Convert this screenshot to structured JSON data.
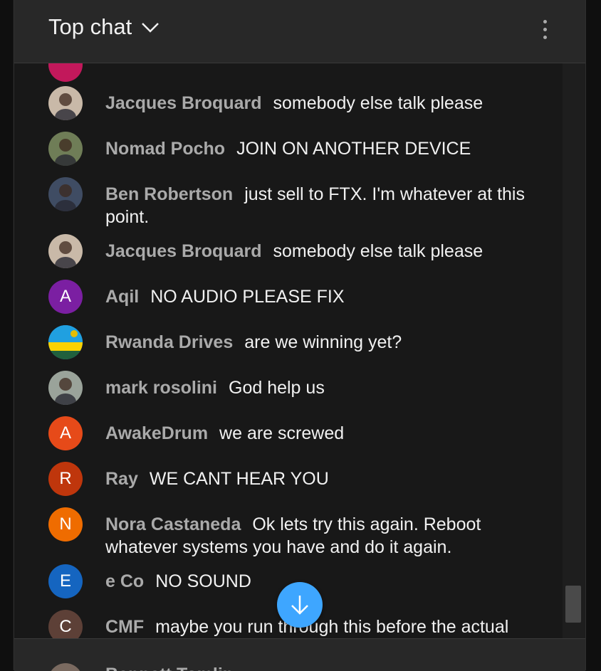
{
  "header": {
    "title": "Top chat",
    "more_label": "More options"
  },
  "messages": [
    {
      "author": "Jacques Broquard",
      "text": "somebody else talk please",
      "avatar": {
        "type": "photo",
        "icon": "person-photo",
        "bg": "#c9b9a8"
      }
    },
    {
      "author": "Nomad Pocho",
      "text": "JOIN ON ANOTHER DEVICE",
      "avatar": {
        "type": "photo",
        "icon": "person-photo",
        "bg": "#6f7d57"
      }
    },
    {
      "author": "Ben Robertson",
      "text": "just sell to FTX. I'm whatever at this point.",
      "avatar": {
        "type": "photo",
        "icon": "person-photo",
        "bg": "#3f4c63"
      }
    },
    {
      "author": "Jacques Broquard",
      "text": "somebody else talk please",
      "avatar": {
        "type": "photo",
        "icon": "person-photo",
        "bg": "#c9b9a8"
      }
    },
    {
      "author": "Aqil",
      "text": "NO AUDIO PLEASE FIX",
      "avatar": {
        "type": "letter",
        "letter": "A",
        "bg": "#7b1fa2"
      }
    },
    {
      "author": "Rwanda Drives",
      "text": "are we winning yet?",
      "avatar": {
        "type": "photo",
        "icon": "flag-photo",
        "bg": "#1e88e5"
      }
    },
    {
      "author": "mark rosolini",
      "text": "God help us",
      "avatar": {
        "type": "photo",
        "icon": "person-photo",
        "bg": "#9aa39a"
      }
    },
    {
      "author": "AwakeDrum",
      "text": "we are screwed",
      "avatar": {
        "type": "letter",
        "letter": "A",
        "bg": "#e64a19"
      }
    },
    {
      "author": "Ray",
      "text": "WE CANT HEAR YOU",
      "avatar": {
        "type": "letter",
        "letter": "R",
        "bg": "#bf360c"
      }
    },
    {
      "author": "Nora Castaneda",
      "text": "Ok lets try this again. Reboot whatever systems you have and do it again.",
      "avatar": {
        "type": "letter",
        "letter": "N",
        "bg": "#ef6c00"
      }
    },
    {
      "author": "e Co",
      "text": "NO SOUND",
      "avatar": {
        "type": "letter",
        "letter": "E",
        "bg": "#1565c0"
      }
    },
    {
      "author": "CMF",
      "text": "maybe you run through this before the actual meeting?",
      "avatar": {
        "type": "letter",
        "letter": "C",
        "bg": "#5d4037"
      }
    }
  ],
  "footer": {
    "author": "Bennett Tomlin"
  },
  "colors": {
    "accent": "#3ea6ff",
    "author_text": "#aaaaaa",
    "message_text": "#f1f1f1"
  }
}
